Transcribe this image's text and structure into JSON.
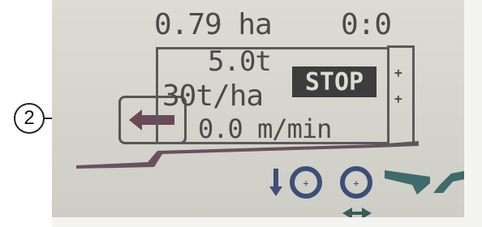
{
  "display": {
    "area_value": "0.79 ha",
    "time_value": "0:0",
    "weight_value": "5.0t",
    "rate_value": "30t/ha",
    "speed_value": "0.0 m/min",
    "stop_label": "STOP"
  },
  "callout": {
    "number": "2"
  },
  "icons": {
    "arrow": "arrow-left-icon",
    "plus_upper": "plus-icon",
    "plus_lower": "plus-icon",
    "down": "arrow-down-icon",
    "disc_left": "spreader-disc-icon",
    "disc_right": "spreader-disc-icon",
    "converge": "converge-arrows-icon",
    "deflector_left": "deflector-left-icon",
    "deflector_right": "deflector-right-icon",
    "ramp": "floor-ramp-icon"
  },
  "colors": {
    "lcd_background": "#d4d4cc",
    "lcd_ink": "#4a4a4a",
    "arrow_fill": "#6b4a57",
    "deflector_fill": "#3e6b6b",
    "disc_ink": "#3d4f78"
  }
}
